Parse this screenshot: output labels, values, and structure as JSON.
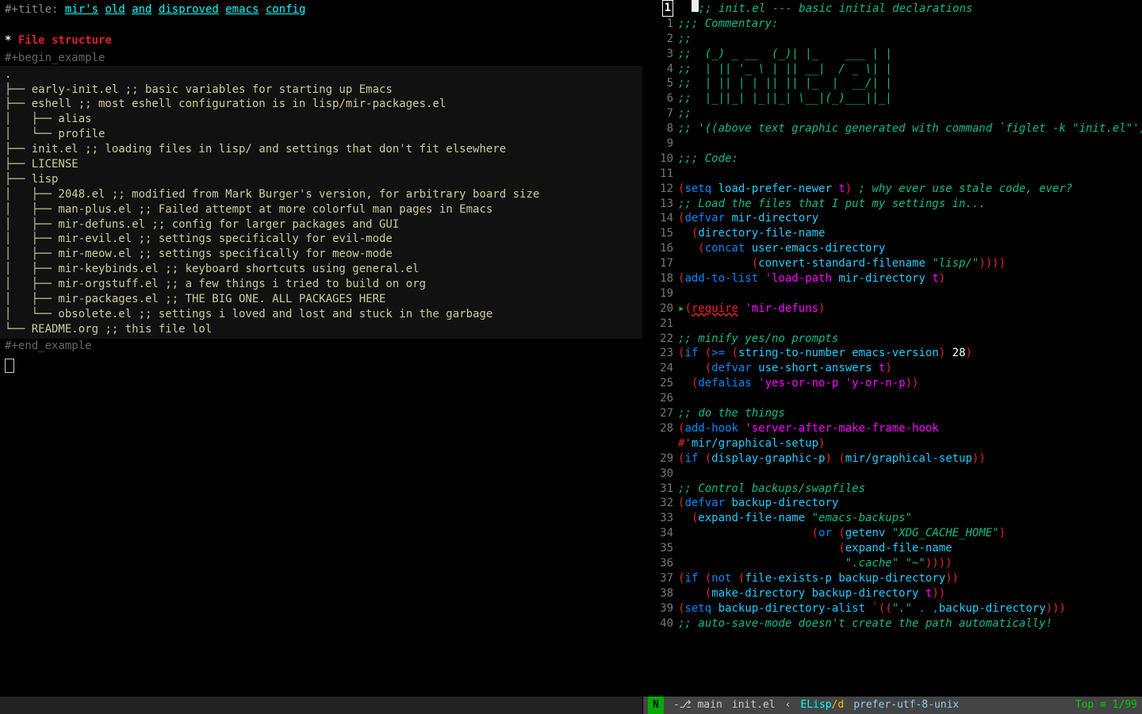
{
  "left": {
    "title_prefix": "#+title:",
    "title_tokens": [
      "mir's",
      "old",
      "and",
      "disproved",
      "emacs",
      "config"
    ],
    "section": "File structure",
    "begin": "#+begin_example",
    "end": "#+end_example",
    "tree": [
      ".",
      "├── early-init.el ;; basic variables for starting up Emacs",
      "├── eshell ;; most eshell configuration is in lisp/mir-packages.el",
      "│   ├── alias",
      "│   └── profile",
      "├── init.el ;; loading files in lisp/ and settings that don't fit elsewhere",
      "├── LICENSE",
      "├── lisp",
      "│   ├── 2048.el ;; modified from Mark Burger's version, for arbitrary board size",
      "│   ├── man-plus.el ;; Failed attempt at more colorful man pages in Emacs",
      "│   ├── mir-defuns.el ;; config for larger packages and GUI",
      "│   ├── mir-evil.el ;; settings specifically for evil-mode",
      "│   ├── mir-meow.el ;; settings specifically for meow-mode",
      "│   ├── mir-keybinds.el ;; keyboard shortcuts using general.el",
      "│   ├── mir-orgstuff.el ;; a few things i tried to build on org",
      "│   ├── mir-packages.el ;; THE BIG ONE. ALL PACKAGES HERE",
      "│   └── obsolete.el ;; settings i loved and lost and stuck in the garbage",
      "└── README.org ;; this file lol"
    ]
  },
  "right": {
    "highlight_lineno": "1",
    "lines": [
      {
        "n": "1",
        "seg": [
          [
            ";;; Commentary:",
            "c-comment"
          ]
        ]
      },
      {
        "n": "2",
        "seg": [
          [
            ";;",
            "c-comment"
          ]
        ]
      },
      {
        "n": "3",
        "seg": [
          [
            ";;  (_) _ __  (_)| |_    ___ | |",
            "c-comment"
          ]
        ]
      },
      {
        "n": "4",
        "seg": [
          [
            ";;  | || '_ \\ | || __|  / _ \\| |",
            "c-comment"
          ]
        ]
      },
      {
        "n": "5",
        "seg": [
          [
            ";;  | || | | || || |_  |  __/| |",
            "c-comment"
          ]
        ]
      },
      {
        "n": "6",
        "seg": [
          [
            ";;  |_||_| |_||_| \\__|(_)___||_|",
            "c-comment"
          ]
        ]
      },
      {
        "n": "7",
        "seg": [
          [
            ";;",
            "c-comment"
          ]
        ]
      },
      {
        "n": "8",
        "seg": [
          [
            ";; '((above text graphic generated with command `figlet -k \"init.el\"'))",
            "c-comment"
          ]
        ]
      },
      {
        "n": "9",
        "seg": [
          [
            "",
            ""
          ]
        ]
      },
      {
        "n": "10",
        "seg": [
          [
            ";;; Code:",
            "c-comment"
          ]
        ]
      },
      {
        "n": "11",
        "seg": [
          [
            "",
            ""
          ]
        ]
      },
      {
        "n": "12",
        "seg": [
          [
            "(",
            "c-par"
          ],
          [
            "setq ",
            "c-fn"
          ],
          [
            "load-prefer-newer ",
            "c-sym"
          ],
          [
            "t",
            "c-def"
          ],
          [
            ")",
            "c-par"
          ],
          [
            " ; why ever use stale code, ever?",
            "c-comment"
          ]
        ]
      },
      {
        "n": "13",
        "seg": [
          [
            ";; Load the files that I put my settings in...",
            "c-comment"
          ]
        ]
      },
      {
        "n": "14",
        "seg": [
          [
            "(",
            "c-par"
          ],
          [
            "defvar ",
            "c-fn"
          ],
          [
            "mir-directory",
            "c-sym"
          ]
        ]
      },
      {
        "n": "15",
        "seg": [
          [
            "  (",
            "c-par"
          ],
          [
            "directory-file-name",
            "c-sym"
          ]
        ]
      },
      {
        "n": "16",
        "seg": [
          [
            "   (",
            "c-par"
          ],
          [
            "concat ",
            "c-fn"
          ],
          [
            "user-emacs-directory",
            "c-sym"
          ]
        ]
      },
      {
        "n": "17",
        "seg": [
          [
            "           (",
            "c-par"
          ],
          [
            "convert-standard-filename ",
            "c-sym"
          ],
          [
            "\"lisp/\"",
            "c-str"
          ],
          [
            "))))",
            "c-par"
          ]
        ]
      },
      {
        "n": "18",
        "seg": [
          [
            "(",
            "c-par"
          ],
          [
            "add-to-list ",
            "c-fn"
          ],
          [
            "'load-path ",
            "c-kw"
          ],
          [
            "mir-directory ",
            "c-sym"
          ],
          [
            "t",
            "c-def"
          ],
          [
            ")",
            "c-par"
          ]
        ]
      },
      {
        "n": "19",
        "seg": [
          [
            "",
            ""
          ]
        ]
      },
      {
        "n": "20",
        "arrow": true,
        "seg": [
          [
            "(",
            "c-par"
          ],
          [
            "require",
            "c-ul"
          ],
          [
            " 'mir-defuns",
            "c-kw"
          ],
          [
            ")",
            "c-par"
          ]
        ]
      },
      {
        "n": "21",
        "seg": [
          [
            "",
            ""
          ]
        ]
      },
      {
        "n": "22",
        "seg": [
          [
            ";; minify yes/no prompts",
            "c-comment"
          ]
        ]
      },
      {
        "n": "23",
        "seg": [
          [
            "(",
            "c-par"
          ],
          [
            "if ",
            "c-fn"
          ],
          [
            "(",
            "c-par"
          ],
          [
            ">= ",
            "c-fn"
          ],
          [
            "(",
            "c-par"
          ],
          [
            "string-to-number ",
            "c-sym"
          ],
          [
            "emacs-version",
            "c-sym"
          ],
          [
            ")",
            "c-par"
          ],
          [
            " 28",
            "c-num"
          ],
          [
            ")",
            "c-par"
          ]
        ]
      },
      {
        "n": "24",
        "seg": [
          [
            "    (",
            "c-par"
          ],
          [
            "defvar ",
            "c-fn"
          ],
          [
            "use-short-answers ",
            "c-sym"
          ],
          [
            "t",
            "c-def"
          ],
          [
            ")",
            "c-par"
          ]
        ]
      },
      {
        "n": "25",
        "seg": [
          [
            "  (",
            "c-par"
          ],
          [
            "defalias ",
            "c-fn"
          ],
          [
            "'yes-or-no-p ",
            "c-kw"
          ],
          [
            "'y-or-n-p",
            "c-kw"
          ],
          [
            "))",
            "c-par"
          ]
        ]
      },
      {
        "n": "26",
        "seg": [
          [
            "",
            ""
          ]
        ]
      },
      {
        "n": "27",
        "seg": [
          [
            ";; do the things",
            "c-comment"
          ]
        ]
      },
      {
        "n": "28",
        "seg": [
          [
            "(",
            "c-par"
          ],
          [
            "add-hook ",
            "c-fn"
          ],
          [
            "'server-after-make-frame-hook",
            "c-kw"
          ]
        ]
      },
      {
        "n": "",
        "seg": [
          [
            "#'",
            "c-hash"
          ],
          [
            "mir/graphical-setup",
            "c-sym"
          ],
          [
            ")",
            "c-par"
          ]
        ]
      },
      {
        "n": "29",
        "seg": [
          [
            "(",
            "c-par"
          ],
          [
            "if ",
            "c-fn"
          ],
          [
            "(",
            "c-par"
          ],
          [
            "display-graphic-p",
            "c-sym"
          ],
          [
            ") (",
            "c-par"
          ],
          [
            "mir/graphical-setup",
            "c-sym"
          ],
          [
            "))",
            "c-par"
          ]
        ]
      },
      {
        "n": "30",
        "seg": [
          [
            "",
            ""
          ]
        ]
      },
      {
        "n": "31",
        "seg": [
          [
            ";; Control backups/swapfiles",
            "c-comment"
          ]
        ]
      },
      {
        "n": "32",
        "seg": [
          [
            "(",
            "c-par"
          ],
          [
            "defvar ",
            "c-fn"
          ],
          [
            "backup-directory",
            "c-sym"
          ]
        ]
      },
      {
        "n": "33",
        "seg": [
          [
            "  (",
            "c-par"
          ],
          [
            "expand-file-name ",
            "c-sym"
          ],
          [
            "\"emacs-backups\"",
            "c-str"
          ]
        ]
      },
      {
        "n": "34",
        "seg": [
          [
            "                    (",
            "c-par"
          ],
          [
            "or ",
            "c-fn"
          ],
          [
            "(",
            "c-par"
          ],
          [
            "getenv ",
            "c-sym"
          ],
          [
            "\"XDG_CACHE_HOME\"",
            "c-str"
          ],
          [
            ")",
            "c-par"
          ]
        ]
      },
      {
        "n": "35",
        "seg": [
          [
            "                        (",
            "c-par"
          ],
          [
            "expand-file-name",
            "c-sym"
          ]
        ]
      },
      {
        "n": "36",
        "seg": [
          [
            "                         \".cache\"",
            "c-str"
          ],
          [
            " \"~\"",
            "c-str"
          ],
          [
            "))))",
            "c-par"
          ]
        ]
      },
      {
        "n": "37",
        "seg": [
          [
            "(",
            "c-par"
          ],
          [
            "if ",
            "c-fn"
          ],
          [
            "(",
            "c-par"
          ],
          [
            "not ",
            "c-fn"
          ],
          [
            "(",
            "c-par"
          ],
          [
            "file-exists-p ",
            "c-sym"
          ],
          [
            "backup-directory",
            "c-sym"
          ],
          [
            "))",
            "c-par"
          ]
        ]
      },
      {
        "n": "38",
        "seg": [
          [
            "    (",
            "c-par"
          ],
          [
            "make-directory ",
            "c-sym"
          ],
          [
            "backup-directory ",
            "c-sym"
          ],
          [
            "t",
            "c-def"
          ],
          [
            "))",
            "c-par"
          ]
        ]
      },
      {
        "n": "39",
        "seg": [
          [
            "(",
            "c-par"
          ],
          [
            "setq ",
            "c-fn"
          ],
          [
            "backup-directory-alist ",
            "c-sym"
          ],
          [
            "`((",
            "c-par"
          ],
          [
            "\".\"",
            "c-str"
          ],
          [
            " . ,",
            "c-fn"
          ],
          [
            "backup-directory",
            "c-sym"
          ],
          [
            ")))",
            "c-par"
          ]
        ]
      },
      {
        "n": "40",
        "seg": [
          [
            ";; auto-save-mode doesn't create the path automatically!",
            "c-comment"
          ]
        ]
      }
    ],
    "first_line_comment": ";; init.el --- basic initial declarations"
  },
  "modeline": {
    "mode_indicator": "N",
    "git": "-⎇ main",
    "buffer": "init.el",
    "sep": "‹",
    "major": "ELisp",
    "minor": "/d",
    "encoding": "prefer-utf-8-unix",
    "position": "Top ≡ 1/99"
  }
}
